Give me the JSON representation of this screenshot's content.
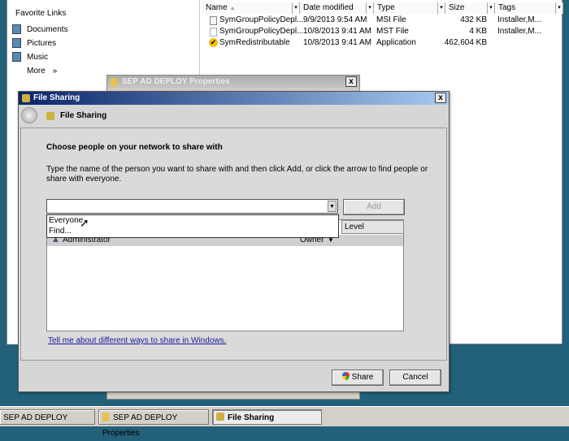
{
  "explorer": {
    "favorites_title": "Favorite Links",
    "favorites": [
      {
        "label": "Documents"
      },
      {
        "label": "Pictures"
      },
      {
        "label": "Music"
      }
    ],
    "more": "More",
    "more_chevron": "»",
    "columns": [
      "Name",
      "Date modified",
      "Type",
      "Size",
      "Tags"
    ],
    "files": [
      {
        "name": "SymGroupPolicyDepl...",
        "date": "9/9/2013 9:54 AM",
        "type": "MSI File",
        "size": "432 KB",
        "tags": "Installer,M...",
        "icon": "msi-file-icon"
      },
      {
        "name": "SymGroupPolicyDepl...",
        "date": "10/8/2013 9:41 AM",
        "type": "MST File",
        "size": "4 KB",
        "tags": "Installer,M...",
        "icon": "mst-file-icon"
      },
      {
        "name": "SymRedistributable",
        "date": "10/8/2013 9:41 AM",
        "type": "Application",
        "size": "462,604 KB",
        "tags": "",
        "icon": "symantec-check-icon"
      }
    ]
  },
  "properties": {
    "title": "SEP AD DEPLOY Properties",
    "close": "x"
  },
  "file_sharing": {
    "title": "File Sharing",
    "close": "x",
    "header": "File Sharing",
    "heading": "Choose people on your network to share with",
    "instructions": "Type the name of the person you want to share with and then click Add, or click the arrow to find people or share with everyone.",
    "combo_value": "",
    "add_label": "Add",
    "dropdown_options": [
      "Everyone",
      "Find..."
    ],
    "level_header": "Level",
    "users": [
      {
        "name": "Administrator",
        "level": "Owner"
      }
    ],
    "help_link": "Tell me about different ways to share in Windows.",
    "share_label": "Share",
    "cancel_label": "Cancel"
  },
  "taskbar": {
    "items": [
      "SEP AD DEPLOY",
      "SEP AD DEPLOY Properties",
      "File Sharing"
    ]
  },
  "colors": {
    "desktop": "#23607a",
    "title_active": "#0a246a",
    "link": "#1a1a9a"
  }
}
